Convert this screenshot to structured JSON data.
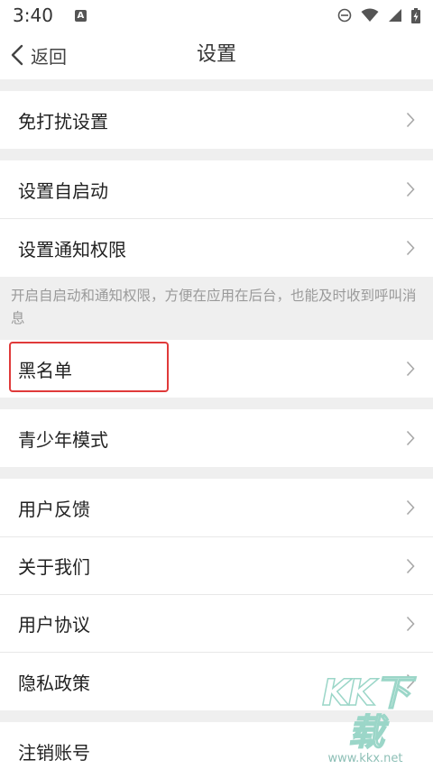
{
  "status_bar": {
    "time": "3:40",
    "badge": "A"
  },
  "nav": {
    "back_label": "返回",
    "title": "设置"
  },
  "items": {
    "dnd": "免打扰设置",
    "autostart": "设置自启动",
    "notify_perm": "设置通知权限",
    "note": "开启自启动和通知权限，方便在应用在后台，也能及时收到呼叫消息",
    "blacklist": "黑名单",
    "youth_mode": "青少年模式",
    "feedback": "用户反馈",
    "about": "关于我们",
    "agreement": "用户协议",
    "privacy": "隐私政策",
    "deregister": "注销账号"
  },
  "watermark": {
    "main": "KK下载",
    "sub": "www.kkx.net"
  },
  "colors": {
    "highlight": "#e03a3a",
    "background": "#efefef",
    "row": "#ffffff"
  }
}
